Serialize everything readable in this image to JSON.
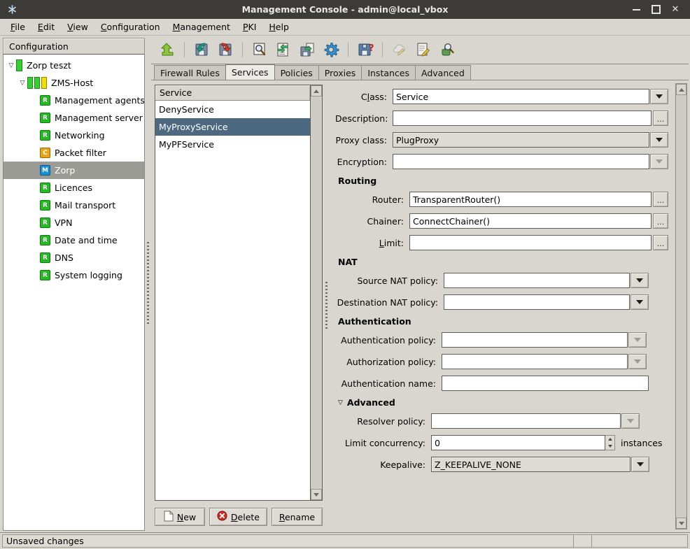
{
  "window": {
    "title": "Management Console - admin@local_vbox",
    "app_icon": "asterisk-icon",
    "minimize": "minimize-button",
    "maximize": "maximize-button",
    "close": "close-button"
  },
  "menu": {
    "items": [
      {
        "label": "File",
        "accel": "F"
      },
      {
        "label": "Edit",
        "accel": "E"
      },
      {
        "label": "View",
        "accel": "V"
      },
      {
        "label": "Configuration",
        "accel": "C"
      },
      {
        "label": "Management",
        "accel": "M"
      },
      {
        "label": "PKI",
        "accel": "P"
      },
      {
        "label": "Help",
        "accel": "H"
      }
    ]
  },
  "sidebar": {
    "header": "Configuration",
    "nodes": [
      {
        "label": "Zorp teszt",
        "level": 0,
        "icon": "green-bar-icon",
        "expander": "▽",
        "selected": false
      },
      {
        "label": "ZMS-Host",
        "level": 1,
        "icon": "green-yellow-bars-icon",
        "expander": "▽",
        "selected": false
      },
      {
        "label": "Management agents",
        "level": 2,
        "icon": "r-badge-icon",
        "expander": "",
        "selected": false
      },
      {
        "label": "Management server",
        "level": 2,
        "icon": "r-badge-icon",
        "expander": "",
        "selected": false
      },
      {
        "label": "Networking",
        "level": 2,
        "icon": "r-badge-icon",
        "expander": "",
        "selected": false
      },
      {
        "label": "Packet filter",
        "level": 2,
        "icon": "c-badge-icon",
        "expander": "",
        "selected": false
      },
      {
        "label": "Zorp",
        "level": 2,
        "icon": "m-badge-icon",
        "expander": "",
        "selected": true
      },
      {
        "label": "Licences",
        "level": 2,
        "icon": "r-badge-icon",
        "expander": "",
        "selected": false
      },
      {
        "label": "Mail transport",
        "level": 2,
        "icon": "r-badge-icon",
        "expander": "",
        "selected": false
      },
      {
        "label": "VPN",
        "level": 2,
        "icon": "r-badge-icon",
        "expander": "",
        "selected": false
      },
      {
        "label": "Date and time",
        "level": 2,
        "icon": "r-badge-icon",
        "expander": "",
        "selected": false
      },
      {
        "label": "DNS",
        "level": 2,
        "icon": "r-badge-icon",
        "expander": "",
        "selected": false
      },
      {
        "label": "System logging",
        "level": 2,
        "icon": "r-badge-icon",
        "expander": "",
        "selected": false
      }
    ]
  },
  "toolbar": {
    "buttons": [
      {
        "name": "upload-config-icon",
        "enabled": true
      },
      {
        "name": "save-import-icon",
        "enabled": true
      },
      {
        "name": "save-export-icon",
        "enabled": true
      },
      {
        "name": "search-icon",
        "enabled": true
      },
      {
        "name": "document-exchange-icon",
        "enabled": true
      },
      {
        "name": "document-export-icon",
        "enabled": true
      },
      {
        "name": "settings-gear-icon",
        "enabled": true
      },
      {
        "name": "save-query-icon",
        "enabled": true
      },
      {
        "name": "cloud-edit-icon",
        "enabled": false
      },
      {
        "name": "document-edit-icon",
        "enabled": true
      },
      {
        "name": "inspect-search-icon",
        "enabled": true
      }
    ]
  },
  "tabs": {
    "items": [
      {
        "label": "Firewall Rules",
        "active": false
      },
      {
        "label": "Services",
        "active": true
      },
      {
        "label": "Policies",
        "active": false
      },
      {
        "label": "Proxies",
        "active": false
      },
      {
        "label": "Instances",
        "active": false
      },
      {
        "label": "Advanced",
        "active": false
      }
    ]
  },
  "service_list": {
    "header": "Service",
    "rows": [
      {
        "label": "DenyService",
        "selected": false
      },
      {
        "label": "MyProxyService",
        "selected": true
      },
      {
        "label": "MyPFService",
        "selected": false
      }
    ],
    "buttons": [
      {
        "label": "New",
        "accel": "N",
        "icon": "new-document-icon"
      },
      {
        "label": "Delete",
        "accel": "D",
        "icon": "delete-circle-icon"
      },
      {
        "label": "Rename",
        "accel": "R",
        "icon": ""
      }
    ]
  },
  "form": {
    "class": {
      "label": "Class:",
      "accel": "l",
      "value": "Service",
      "control": "editable-combo"
    },
    "description": {
      "label": "Description:",
      "value": "",
      "control": "text-with-browse",
      "browse": "..."
    },
    "proxy_class": {
      "label": "Proxy class:",
      "value": "PlugProxy",
      "control": "combo"
    },
    "encryption": {
      "label": "Encryption:",
      "value": "",
      "control": "combo-disabled"
    },
    "routing": {
      "title": "Routing",
      "router": {
        "label": "Router:",
        "value": "TransparentRouter()",
        "browse": "..."
      },
      "chainer": {
        "label": "Chainer:",
        "value": "ConnectChainer()",
        "browse": "..."
      },
      "limit": {
        "label": "Limit:",
        "accel": "L",
        "value": "",
        "browse": "..."
      }
    },
    "nat": {
      "title": "NAT",
      "source": {
        "label": "Source NAT policy:",
        "value": "",
        "control": "combo"
      },
      "destination": {
        "label": "Destination NAT policy:",
        "value": "",
        "control": "combo"
      }
    },
    "authentication": {
      "title": "Authentication",
      "auth_policy": {
        "label": "Authentication policy:",
        "value": "",
        "control": "combo-disabled"
      },
      "authz_policy": {
        "label": "Authorization policy:",
        "value": "",
        "control": "combo-disabled"
      },
      "auth_name": {
        "label": "Authentication name:",
        "value": "",
        "control": "text"
      }
    },
    "advanced": {
      "title": "Advanced",
      "expander": "▽",
      "resolver": {
        "label": "Resolver policy:",
        "value": "",
        "control": "combo-disabled"
      },
      "limit_concurrency": {
        "label": "Limit concurrency:",
        "value": "0",
        "unit": "instances"
      },
      "keepalive": {
        "label": "Keepalive:",
        "value": "Z_KEEPALIVE_NONE",
        "control": "combo"
      }
    }
  },
  "statusbar": {
    "message": "Unsaved changes"
  },
  "colors": {
    "titlebar": "#3c3b37",
    "window_bg": "#d9d6cf",
    "list_selection": "#4d6982",
    "tree_selection": "#9c9c96",
    "badge_green": "#24bb24",
    "badge_orange": "#e8a317",
    "badge_blue": "#1a8fd1"
  }
}
